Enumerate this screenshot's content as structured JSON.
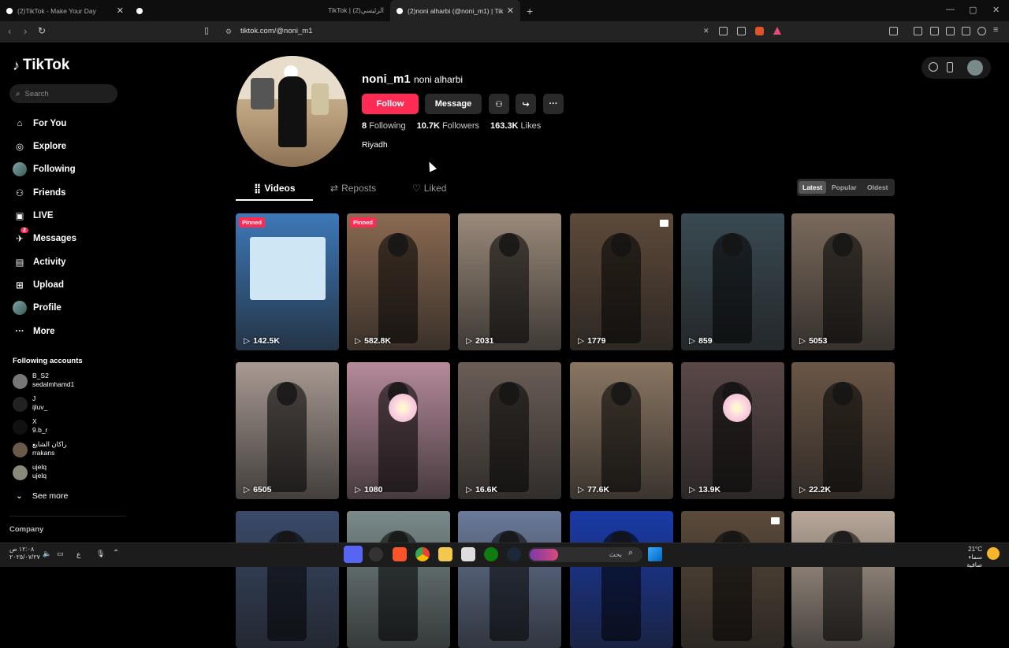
{
  "browser": {
    "tabs": [
      {
        "title": "(2)TikTok - Make Your Day"
      },
      {
        "title": ""
      },
      {
        "title": "TikTok | الرئيسي(2)"
      },
      {
        "title": "(2)noni alharbi (@noni_m1) | Tik"
      }
    ],
    "url": "tiktok.com/@noni_m1"
  },
  "sidebar": {
    "logo": "TikTok",
    "search_placeholder": "Search",
    "nav": [
      {
        "label": "For You",
        "icon": "home-icon"
      },
      {
        "label": "Explore",
        "icon": "compass-icon"
      },
      {
        "label": "Following",
        "icon": "avatar-icon"
      },
      {
        "label": "Friends",
        "icon": "friends-icon"
      },
      {
        "label": "LIVE",
        "icon": "live-icon"
      },
      {
        "label": "Messages",
        "icon": "messages-icon",
        "badge": "2"
      },
      {
        "label": "Activity",
        "icon": "activity-icon"
      },
      {
        "label": "Upload",
        "icon": "upload-icon"
      },
      {
        "label": "Profile",
        "icon": "profile-icon"
      },
      {
        "label": "More",
        "icon": "more-icon"
      }
    ],
    "following_title": "Following accounts",
    "following": [
      {
        "name": "B_S2",
        "handle": "sedalmhamd1"
      },
      {
        "name": "J",
        "handle": "ijluv_"
      },
      {
        "name": "X",
        "handle": "9.b_r"
      },
      {
        "name": "راكان الشايع",
        "handle": "rrakans"
      },
      {
        "name": "ujelq",
        "handle": "ujelq"
      }
    ],
    "see_more": "See more",
    "company": "Company"
  },
  "profile": {
    "username": "noni_m1",
    "nickname": "noni alharbi",
    "follow_label": "Follow",
    "message_label": "Message",
    "following_count": "8",
    "following_label": "Following",
    "followers_count": "10.7K",
    "followers_label": "Followers",
    "likes_count": "163.3K",
    "likes_label": "Likes",
    "bio": "Riyadh"
  },
  "tabs": [
    {
      "label": "Videos",
      "icon": "grid-icon"
    },
    {
      "label": "Reposts",
      "icon": "repost-icon"
    },
    {
      "label": "Liked",
      "icon": "heart-icon"
    }
  ],
  "sort": [
    "Latest",
    "Popular",
    "Oldest"
  ],
  "videos": [
    {
      "views": "142.5K",
      "pinned": "Pinned",
      "color": "#3d78b8"
    },
    {
      "views": "582.8K",
      "pinned": "Pinned",
      "color": "#8a6a52"
    },
    {
      "views": "2031",
      "pinned": "",
      "color": "#9a8a7a"
    },
    {
      "views": "1779",
      "pinned": "",
      "color": "#5d4a3a"
    },
    {
      "views": "859",
      "pinned": "",
      "color": "#3a4a52"
    },
    {
      "views": "5053",
      "pinned": "",
      "color": "#7a6a5c"
    },
    {
      "views": "6505",
      "pinned": "",
      "color": "#a89a92"
    },
    {
      "views": "1080",
      "pinned": "",
      "color": "#b58a9a"
    },
    {
      "views": "16.6K",
      "pinned": "",
      "color": "#6a5e56"
    },
    {
      "views": "77.6K",
      "pinned": "",
      "color": "#8a7662"
    },
    {
      "views": "13.9K",
      "pinned": "",
      "color": "#5a4848"
    },
    {
      "views": "22.2K",
      "pinned": "",
      "color": "#6a5646"
    },
    {
      "views": "",
      "pinned": "",
      "color": "#3a4a6a"
    },
    {
      "views": "",
      "pinned": "",
      "color": "#7a8a8a"
    },
    {
      "views": "",
      "pinned": "",
      "color": "#6a7a9a"
    },
    {
      "views": "",
      "pinned": "",
      "color": "#1a3aa8"
    },
    {
      "views": "",
      "pinned": "",
      "color": "#5a4a3a"
    },
    {
      "views": "",
      "pinned": "",
      "color": "#b8a89a"
    }
  ],
  "taskbar": {
    "time": "١٢:٠٨ ص",
    "date": "٢٠٢٥/٠٧/٢٧",
    "search_placeholder": "بحث",
    "temp": "21°C",
    "weather": "سماء صافية",
    "lang": "ع"
  }
}
